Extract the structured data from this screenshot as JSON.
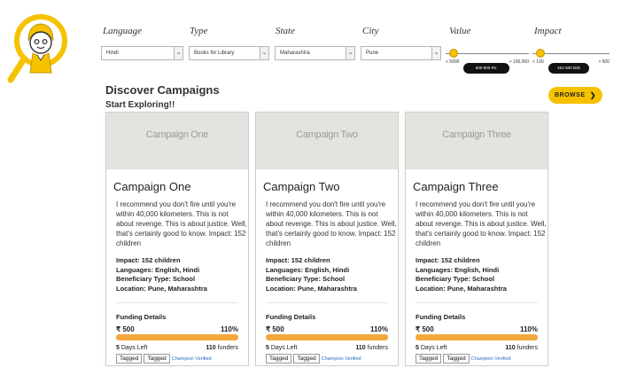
{
  "filters": {
    "language": {
      "label": "Language",
      "value": "Hindi"
    },
    "type": {
      "label": "Type",
      "value": "Books for Library"
    },
    "state": {
      "label": "State",
      "value": "Maharashtra"
    },
    "city": {
      "label": "City",
      "value": "Pune"
    },
    "value": {
      "label": "Value",
      "min_label": "< 5000",
      "max_label": "> 100,000",
      "tooltip": "500-800 Rs.",
      "level": 0.05
    },
    "impact": {
      "label": "Impact",
      "min_label": "< 100",
      "max_label": "> 500",
      "tooltip": "251-500 kids",
      "level": 0.05
    }
  },
  "header": {
    "title": "Discover Campaigns",
    "subtitle": "Start Exploring!!",
    "browse_label": "BROWSE"
  },
  "campaigns": [
    {
      "thumb": "Campaign One",
      "title": "Campaign One",
      "description": "I recommend you don't fire until you're within 40,000 kilometers. This is not about revenge. This is about justice. Well, that's certainly good to know. Impact: 152 children",
      "impact": "Impact: 152 children",
      "languages": "Languages: English, Hindi",
      "beneficiary": "Beneficiary Type: School",
      "location": "Location: Pune, Maharashtra",
      "funding_heading": "Funding Details",
      "amount": "₹ 500",
      "percent": "110%",
      "progress": 1.0,
      "days_num": "5",
      "days_text": " Days Left",
      "funders_num": "110",
      "funders_text": " funders",
      "tag1": "Tagged",
      "tag2": "Tagged",
      "champion": "Champion Verified"
    },
    {
      "thumb": "Campaign Two",
      "title": "Campaign Two",
      "description": "I recommend you don't fire until you're within 40,000 kilometers. This is not about revenge. This is about justice. Well, that's certainly good to know. Impact: 152 children",
      "impact": "Impact: 152 children",
      "languages": "Languages: English, Hindi",
      "beneficiary": "Beneficiary Type: School",
      "location": "Location: Pune, Maharashtra",
      "funding_heading": "Funding Details",
      "amount": "₹ 500",
      "percent": "110%",
      "progress": 1.0,
      "days_num": "5",
      "days_text": " Days Left",
      "funders_num": "110",
      "funders_text": " funders",
      "tag1": "Tagged",
      "tag2": "Tagged",
      "champion": "Champion Verified"
    },
    {
      "thumb": "Campaign Three",
      "title": "Campaign Three",
      "description": "I recommend you don't fire until you're within 40,000 kilometers. This is not about revenge. This is about justice. Well, that's certainly good to know. Impact: 152 children",
      "impact": "Impact: 152 children",
      "languages": "Languages: English, Hindi",
      "beneficiary": "Beneficiary Type: School",
      "location": "Location: Pune, Maharashtra",
      "funding_heading": "Funding Details",
      "amount": "₹ 500",
      "percent": "110%",
      "progress": 1.0,
      "days_num": "5",
      "days_text": " Days Left",
      "funders_num": "110",
      "funders_text": " funders",
      "tag1": "Tagged",
      "tag2": "Tagged",
      "champion": "Champion Verified"
    }
  ],
  "colors": {
    "accent": "#f6c200",
    "progress": "#f3a83c",
    "thumb_bg": "#e4e3df",
    "link": "#2a6fc0"
  },
  "icons": {
    "logo": "magnifier-child-icon",
    "browse": "chevron-right-icon",
    "select": "chevron-down-icon"
  }
}
